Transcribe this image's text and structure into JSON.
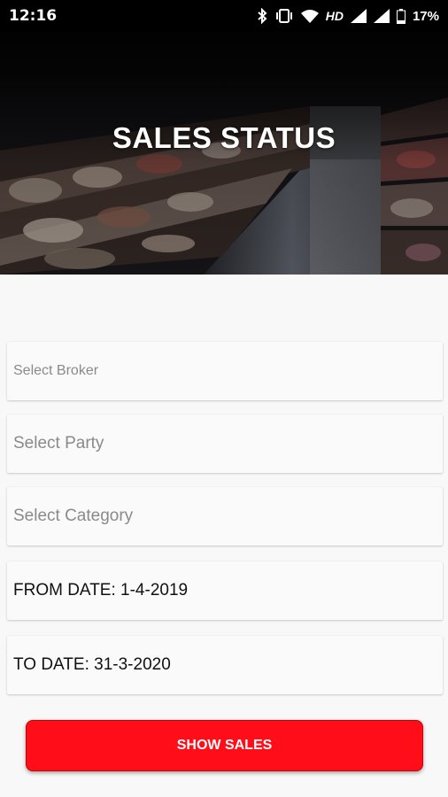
{
  "status_bar": {
    "time": "12:16",
    "network_label": "HD",
    "battery": "17%",
    "icons": [
      "bluetooth-icon",
      "vibrate-icon",
      "wifi-icon",
      "signal-icon",
      "signal-icon",
      "battery-icon"
    ]
  },
  "header": {
    "title": "SALES STATUS"
  },
  "form": {
    "broker_placeholder": "Select Broker",
    "party_placeholder": "Select Party",
    "category_placeholder": "Select Category",
    "from_date": "FROM DATE: 1-4-2019",
    "to_date": "TO DATE: 31-3-2020"
  },
  "actions": {
    "show_sales_label": "SHOW SALES",
    "button_color": "#ff0d19"
  }
}
